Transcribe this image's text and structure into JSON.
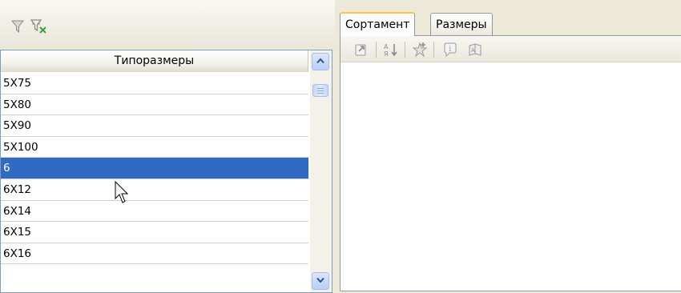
{
  "left_panel": {
    "toolbar_icons": [
      "filter-icon",
      "filter-clear-icon"
    ],
    "list_header": "Типоразмеры",
    "rows": [
      "5X75",
      "5X80",
      "5X90",
      "5X100",
      "6",
      "6X12",
      "6X14",
      "6X15",
      "6X16"
    ],
    "selected_index": 4,
    "selection_color": "#316ac5"
  },
  "tabs": [
    {
      "label": "Сортамент",
      "active": true
    },
    {
      "label": "Размеры",
      "active": false
    }
  ],
  "right_toolbar_icons": [
    "export-icon",
    "sort-icon",
    "add-to-favorites-icon",
    "info-icon",
    "catalog-icon"
  ],
  "colors": {
    "window_bg": "#ece9d8",
    "tab_highlight": "#ffc83c",
    "list_border": "#7f9db9"
  }
}
